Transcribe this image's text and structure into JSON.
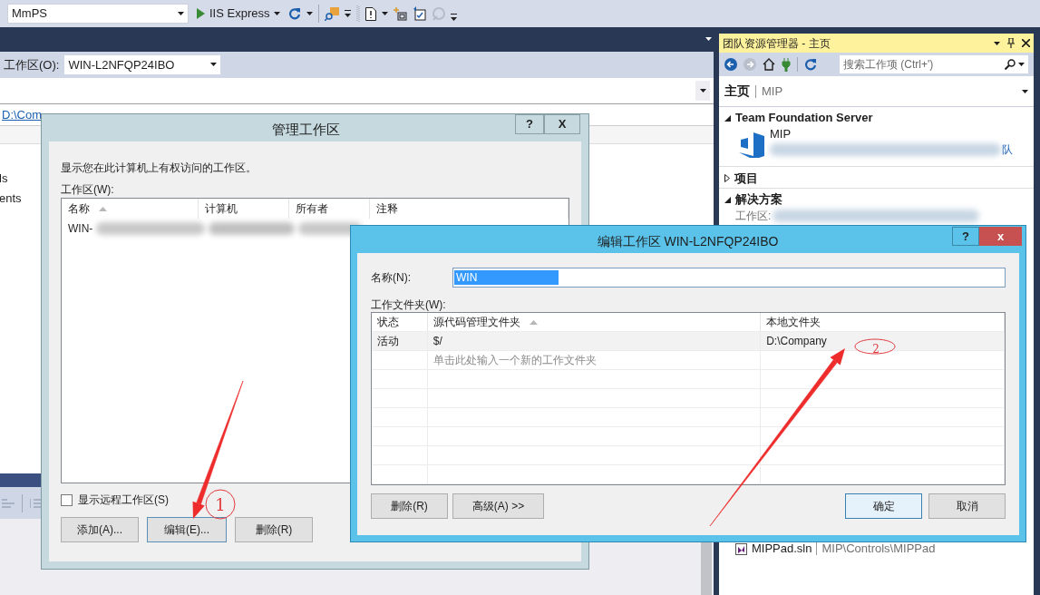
{
  "toolbar": {
    "project": "MmPS",
    "run_target": "IIS Express"
  },
  "document": {
    "workspace_label": "工作区(O):",
    "workspace": "WIN-L2NFQP24IBO",
    "path_link": "D:\\Com",
    "side_items": [
      "ls",
      "ents"
    ]
  },
  "team_explorer": {
    "title": "团队资源管理器 - 主页",
    "search": {
      "placeholder": "搜索工作项 (Ctrl+')"
    },
    "page": "主页",
    "project": "MIP",
    "sections": [
      {
        "title": "Team Foundation Server",
        "expanded": true
      },
      {
        "title": "项目",
        "expanded": false
      },
      {
        "title": "解决方案",
        "expanded": true
      }
    ],
    "server": {
      "name": "MIP",
      "link": "队"
    },
    "workspace_label": "工作区:",
    "solution": {
      "name": "MIPPad.sln",
      "path": "MIP\\Controls\\MIPPad"
    }
  },
  "manage_dialog": {
    "title": "管理工作区",
    "help": "?",
    "close": "X",
    "description": "显示您在此计算机上有权访问的工作区。",
    "list_label": "工作区(W):",
    "columns": [
      {
        "label": "名称",
        "sorted": true
      },
      {
        "label": "计算机",
        "sorted": false
      },
      {
        "label": "所有者",
        "sorted": false
      },
      {
        "label": "注释",
        "sorted": false
      }
    ],
    "rows": [
      {
        "name": "WIN-"
      }
    ],
    "show_remote": {
      "label": "显示远程工作区(S)",
      "checked": false
    },
    "buttons": [
      "添加(A)...",
      "编辑(E)...",
      "删除(R)"
    ]
  },
  "edit_dialog": {
    "title": "编辑工作区 WIN-L2NFQP24IBO",
    "help": "?",
    "close": "x",
    "name_label": "名称(N):",
    "name_value": "WIN",
    "folders_label": "工作文件夹(W):",
    "columns": [
      {
        "label": "状态",
        "sorted": false
      },
      {
        "label": "源代码管理文件夹",
        "sorted": true
      },
      {
        "label": "本地文件夹",
        "sorted": false
      }
    ],
    "rows": [
      {
        "status": "活动",
        "server_folder": "$/",
        "local_folder": "D:\\Company"
      }
    ],
    "new_row_placeholder": "单击此处输入一个新的工作文件夹",
    "left_buttons": [
      "删除(R)",
      "高级(A) >>"
    ],
    "right_buttons": [
      {
        "label": "确定",
        "selected": true
      },
      {
        "label": "取消",
        "selected": false
      }
    ]
  },
  "annotations": [
    {
      "label": "1"
    },
    {
      "label": "2"
    }
  ]
}
